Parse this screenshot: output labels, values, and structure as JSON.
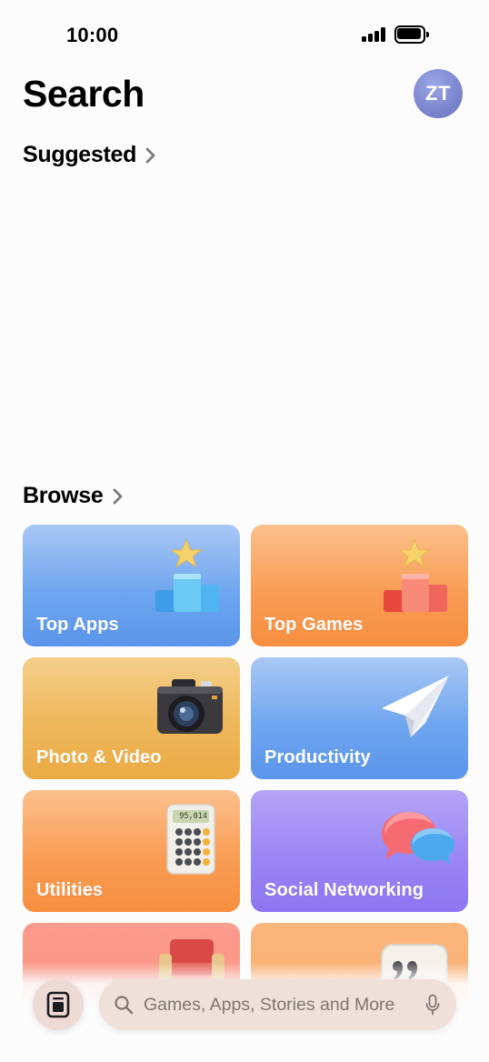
{
  "status_bar": {
    "time": "10:00"
  },
  "header": {
    "title": "Search",
    "avatar_initials": "ZT"
  },
  "sections": {
    "suggested": "Suggested",
    "browse": "Browse"
  },
  "categories": [
    {
      "label": "Top Apps",
      "icon": "podium-star-blue-icon"
    },
    {
      "label": "Top Games",
      "icon": "podium-star-red-icon"
    },
    {
      "label": "Photo & Video",
      "icon": "camera-icon"
    },
    {
      "label": "Productivity",
      "icon": "paper-plane-icon"
    },
    {
      "label": "Utilities",
      "icon": "calculator-icon",
      "display_value": "95,014"
    },
    {
      "label": "Social Networking",
      "icon": "chat-bubbles-icon"
    },
    {
      "label": "",
      "icon": "armchair-icon"
    },
    {
      "label": "",
      "icon": "quote-icon"
    }
  ],
  "search": {
    "placeholder": "Games, Apps, Stories and More"
  },
  "colors": {
    "blue_tile": "#6fa6ef",
    "orange_tile": "#f99d55",
    "gold_tile": "#eeb75a",
    "purple_tile": "#9a86f4",
    "salmon_tile": "#f88b7b",
    "peach_tile": "#f9a969",
    "avatar": "#7b86cf",
    "search_bar": "#f0e0da"
  }
}
